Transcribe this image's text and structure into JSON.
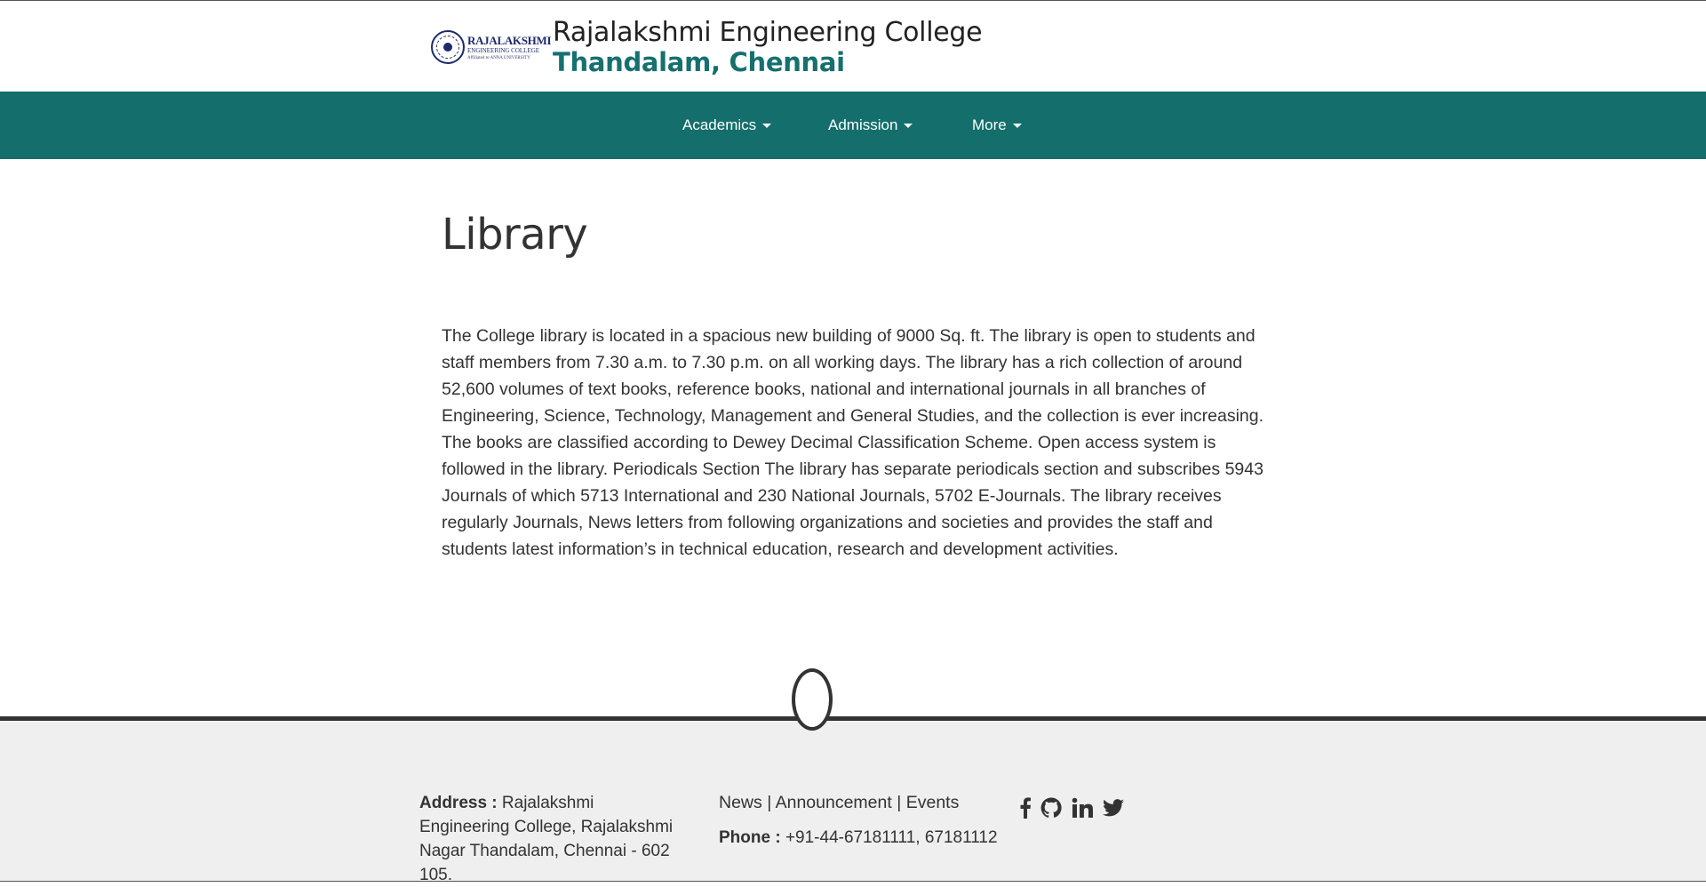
{
  "header": {
    "logo": {
      "line1": "RAJALAKSHMI",
      "line2": "ENGINEERING COLLEGE",
      "line3": "An AUTONOMOUS Institution, Affiliated to ANNA UNIVERSITY, Chennai"
    },
    "title": "Rajalakshmi Engineering College",
    "subtitle": "Thandalam, Chennai"
  },
  "nav": {
    "items": [
      {
        "label": "Academics"
      },
      {
        "label": "Admission"
      },
      {
        "label": "More"
      }
    ]
  },
  "main": {
    "title": "Library",
    "body": "The College library is located in a spacious new building of 9000 Sq. ft. The library is open to students and staff members from 7.30 a.m. to 7.30 p.m. on all working days. The library has a rich collection of around 52,600 volumes of text books, reference books, national and international journals in all branches of Engineering, Science, Technology, Management and General Studies, and the collection is ever increasing. The books are classified according to Dewey Decimal Classification Scheme. Open access system is followed in the library. Periodicals Section The library has separate periodicals section and subscribes 5943 Journals of which 5713 International and 230 National Journals, 5702 E-Journals. The library receives regularly Journals, News letters from following organizations and societies and provides the staff and students latest information’s in technical education, research and development activities."
  },
  "footer": {
    "address_label": "Address :",
    "address_value": "Rajalakshmi Engineering College, Rajalakshmi Nagar Thandalam, Chennai - 602 105.",
    "links": [
      {
        "label": "News"
      },
      {
        "label": "Announcement"
      },
      {
        "label": "Events"
      }
    ],
    "separator": "|",
    "phone_label": "Phone :",
    "phone_value": "+91-44-67181111, 67181112",
    "social": [
      {
        "icon": "facebook-icon"
      },
      {
        "icon": "github-icon"
      },
      {
        "icon": "linkedin-icon"
      },
      {
        "icon": "twitter-icon"
      }
    ]
  },
  "colors": {
    "brand_teal": "#136e6c",
    "subtitle_teal": "#16706e",
    "text": "#333333",
    "footer_bg": "#efefef"
  }
}
